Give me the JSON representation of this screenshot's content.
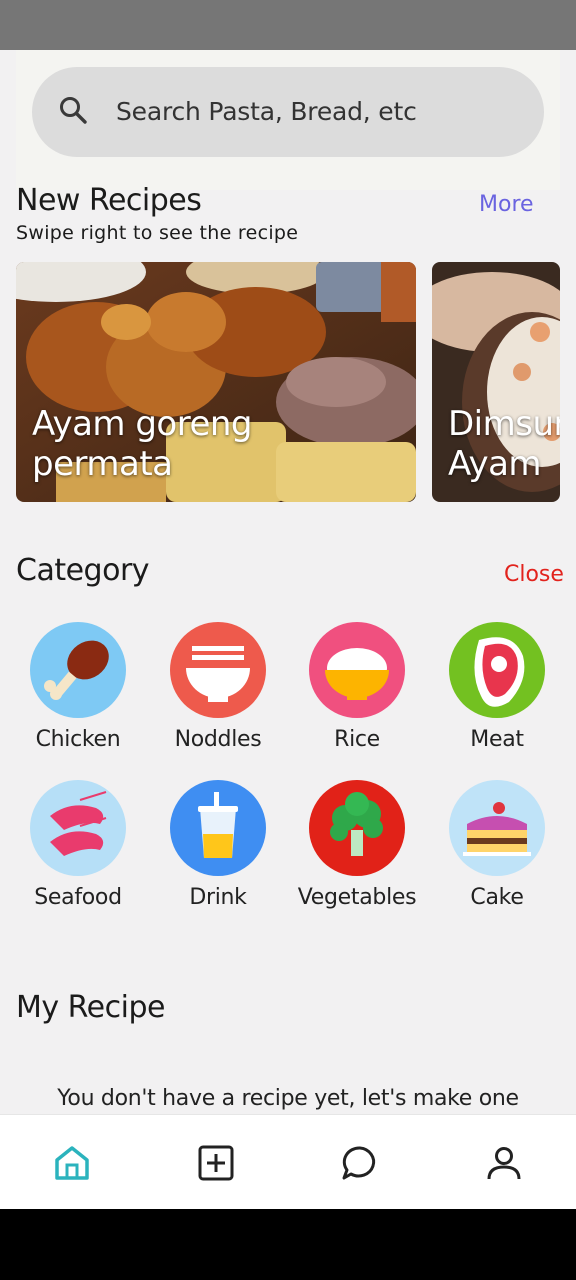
{
  "search": {
    "placeholder": "Search Pasta, Bread, etc"
  },
  "new_recipes": {
    "title": "New Recipes",
    "subtitle": "Swipe right to see the recipe",
    "more_label": "More",
    "cards": [
      {
        "line1": "Ayam goreng",
        "line2": "permata"
      },
      {
        "line1": "Dimsum",
        "line2": "Ayam"
      }
    ]
  },
  "category": {
    "title": "Category",
    "close_label": "Close",
    "items": [
      {
        "label": "Chicken",
        "icon": "chicken-leg-icon",
        "color": "#7ec9f4"
      },
      {
        "label": "Noddles",
        "icon": "noodle-bowl-icon",
        "color": "#ee5a4c"
      },
      {
        "label": "Rice",
        "icon": "rice-bowl-icon",
        "color": "#f0507f"
      },
      {
        "label": "Meat",
        "icon": "steak-icon",
        "color": "#73c121"
      },
      {
        "label": "Seafood",
        "icon": "shrimp-icon",
        "color": "#b6dff7"
      },
      {
        "label": "Drink",
        "icon": "drink-cup-icon",
        "color": "#3f8ef2"
      },
      {
        "label": "Vegetables",
        "icon": "broccoli-icon",
        "color": "#e12218"
      },
      {
        "label": "Cake",
        "icon": "cake-icon",
        "color": "#bfe3f8"
      }
    ]
  },
  "my_recipe": {
    "title": "My Recipe",
    "empty_text": "You don't have a recipe yet, let's make one"
  },
  "nav": {
    "items": [
      {
        "name": "home",
        "icon": "home-icon",
        "active": true
      },
      {
        "name": "add",
        "icon": "add-square-icon",
        "active": false
      },
      {
        "name": "chat",
        "icon": "chat-bubble-icon",
        "active": false
      },
      {
        "name": "profile",
        "icon": "person-icon",
        "active": false
      }
    ],
    "active_color": "#2bb3bd"
  }
}
